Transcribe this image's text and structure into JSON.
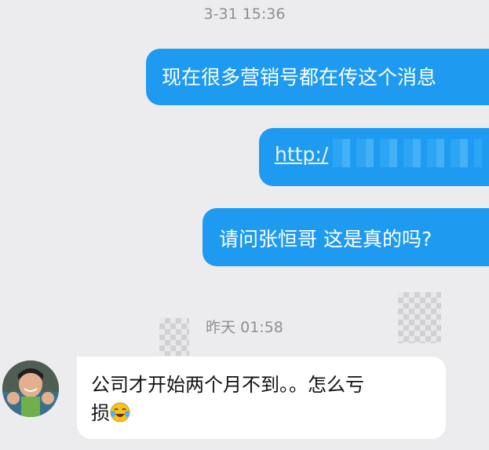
{
  "conversation": {
    "timestamp_1": "3-31 15:36",
    "sent_messages": [
      {
        "text": "现在很多营销号都在传这个消息"
      },
      {
        "link_text": "http:/"
      },
      {
        "text": "请问张恒哥  这是真的吗?"
      }
    ],
    "timestamp_2": "昨天 01:58",
    "received_message": {
      "line1": "公司才开始两个月不到。。怎么亏",
      "line2": "损"
    },
    "colors": {
      "sent_bubble": "#1e9bf0",
      "received_bubble": "#ffffff",
      "background": "#ececef"
    },
    "icons": {
      "avatar": "contact-avatar",
      "emoji": "crying-laughing-emoji"
    }
  }
}
